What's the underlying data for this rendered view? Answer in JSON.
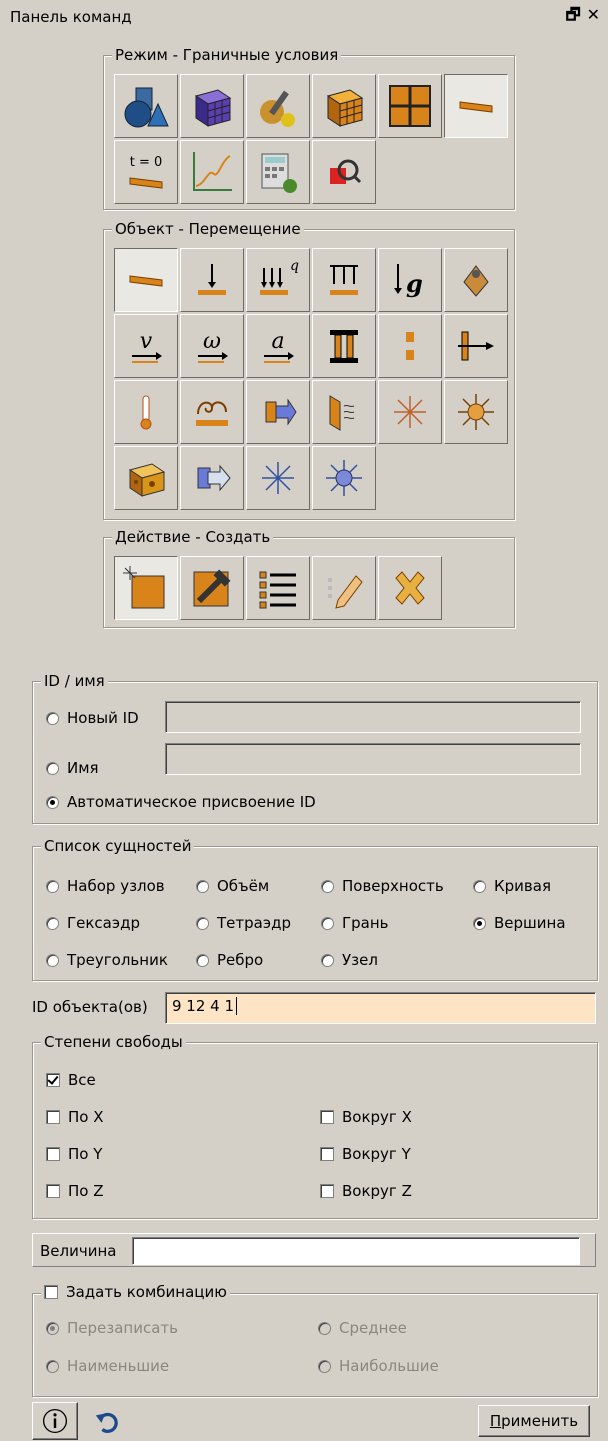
{
  "panel": {
    "title": "Панель команд"
  },
  "mode_group": {
    "legend": "Режим - Граничные условия"
  },
  "object_group": {
    "legend": "Объект - Перемещение"
  },
  "action_group": {
    "legend": "Действие - Создать"
  },
  "id_group": {
    "legend": "ID / имя",
    "new_id_label": "Новый ID",
    "name_label": "Имя",
    "auto_label": "Автоматическое присвоение ID",
    "selected": "auto"
  },
  "entity_group": {
    "legend": "Список сущностей",
    "options": [
      "Набор узлов",
      "Объём",
      "Поверхность",
      "Кривая",
      "Гексаэдр",
      "Тетраэдр",
      "Грань",
      "Вершина",
      "Треугольник",
      "Ребро",
      "Узел"
    ],
    "selected": "Вершина"
  },
  "object_ids": {
    "label": "ID объекта(ов)",
    "value": "9 12 4 1"
  },
  "dof_group": {
    "legend": "Степени свободы",
    "all": "Все",
    "x": "По X",
    "y": "По Y",
    "z": "По Z",
    "rx": "Вокруг X",
    "ry": "Вокруг Y",
    "rz": "Вокруг Z",
    "all_checked": true
  },
  "magnitude": {
    "label": "Величина",
    "value": ""
  },
  "combo_group": {
    "legend": "Задать комбинацию",
    "checked": false,
    "overwrite": "Перезаписать",
    "average": "Среднее",
    "smallest": "Наименьшие",
    "largest": "Наибольшие",
    "selected": "overwrite"
  },
  "footer": {
    "apply_label": "Применить",
    "apply_accel": "П"
  },
  "colors": {
    "panel_bg": "#d4d0c8",
    "input_highlight": "#fce4c4",
    "orange": "#d9841a",
    "blue": "#1e4a8c"
  }
}
